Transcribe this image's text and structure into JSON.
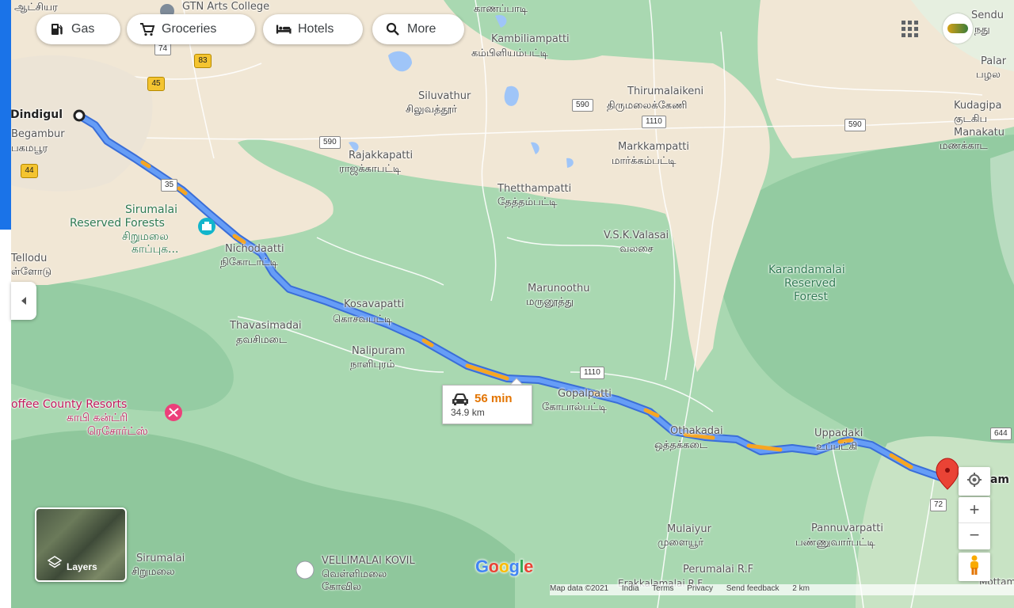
{
  "chips": [
    {
      "label": "Gas",
      "icon": "gas-station-icon"
    },
    {
      "label": "Groceries",
      "icon": "cart-icon"
    },
    {
      "label": "Hotels",
      "icon": "bed-icon"
    },
    {
      "label": "More",
      "icon": "search-icon"
    }
  ],
  "route": {
    "duration": "56 min",
    "distance": "34.9 km"
  },
  "places": {
    "origin": "Dindigul",
    "gtn": "GTN Arts College",
    "kanappadi": "காணப்பாடி",
    "aathiyar": "ஆட்சியர",
    "kambiliampatti_en": "Kambiliampatti",
    "kambiliampatti_ta": "கம்பிளியம்பட்டி",
    "siluvathur_en": "Siluvathur",
    "siluvathur_ta": "சிலுவத்தூர்",
    "thirumalaikeni_en": "Thirumalaikeni",
    "thirumalaikeni_ta": "திருமலைக்கேணி",
    "sendu": "Sendu",
    "sendu_ta": "நது",
    "palar": "Palar",
    "palar_ta": "பழல",
    "kudagipa": "Kudagipa",
    "kudagipa_ta": "குடகிப",
    "manakattu": "Manakatu",
    "manakattu_ta": "மணக்காட",
    "begambur": "Begambur",
    "begambur_ta": "பகமபூர",
    "rajakkapatti_en": "Rajakkapatti",
    "rajakkapatti_ta": "ராஜக்காபட்டி",
    "markkampatti_en": "Markkampatti",
    "markkampatti_ta": "மார்க்கம்பட்டி",
    "thethampatti_en": "Thetthampatti",
    "thethampatti_ta": "தேத்தம்பட்டி",
    "sirumalai_rf_1": "Sirumalai",
    "sirumalai_rf_2": "Reserved Forests",
    "sirumalai_rf_ta1": "சிறுமலை",
    "sirumalai_rf_ta2": "காப்புக...",
    "nichodaatti_en": "Nichodaatti",
    "nichodaatti_ta": "நிகோடாட்டி",
    "vsk_en": "V.S.K.Valasai",
    "vsk_ta": "வலசை",
    "karandamalai_1": "Karandamalai",
    "karandamalai_2": "Reserved",
    "karandamalai_3": "Forest",
    "tellodu_en": "Tellodu",
    "tellodu_ta": "ள்ளோடு",
    "marunoothu_en": "Marunoothu",
    "marunoothu_ta": "மருனூத்து",
    "kosavapatti_en": "Kosavapatti",
    "kosavapatti_ta": "கொசவபட்டி",
    "thavasimadai_en": "Thavasimadai",
    "thavasimadai_ta": "தவசிமடை",
    "nalipuram_en": "Nalipuram",
    "nalipuram_ta": "நாளிபுரம்",
    "gopalpatti_en": "Gopalpatti",
    "gopalpatti_ta": "கோபால்பட்டி",
    "othakadai_en": "Othakadai",
    "othakadai_ta": "ஒத்தக்கடை",
    "uppadaki_en": "Uppadaki",
    "uppadaki_ta": "உப்பட்கி",
    "coffee_en": "offee County Resorts",
    "coffee_ta1": "காபி கன்ட்ரி",
    "coffee_ta2": "ரெசோர்ட்ஸ்",
    "mulaiyur_en": "Mulaiyur",
    "mulaiyur_ta": "முளையூர்",
    "pannuvarpatti_en": "Pannuvarpatti",
    "pannuvarpatti_ta": "பண்ணுவார்பட்டி",
    "sirumalai_en": "Sirumalai",
    "sirumalai_ta": "சிறுமலை",
    "vellimalai_en": "VELLIMALAI KOVIL",
    "vellimalai_ta1": "வெள்ளிமலை",
    "vellimalai_ta2": "கோவில",
    "perumalai": "Perumalai R.F",
    "erakkalamalai": "Erakkalamalai R.F",
    "mottama": "Mottama",
    "dest": "ham"
  },
  "roads": {
    "r74": "74",
    "r83": "83",
    "r45": "45",
    "r44": "44",
    "r35": "35",
    "r590a": "590",
    "r590b": "590",
    "r590c": "590",
    "r1110a": "1110",
    "r1110b": "1110",
    "r72": "72",
    "r644": "644"
  },
  "controls": {
    "layers": "Layers",
    "zoom_in": "+",
    "zoom_out": "−",
    "logo": "Google"
  },
  "footer": {
    "mapdata": "Map data ©2021",
    "india": "India",
    "terms": "Terms",
    "privacy": "Privacy",
    "feedback": "Send feedback",
    "scale": "2 km"
  },
  "colors": {
    "route": "#4285f4",
    "traffic": "#f6a623",
    "forest": "#a9d8b1",
    "urban": "#f1e7d5"
  }
}
